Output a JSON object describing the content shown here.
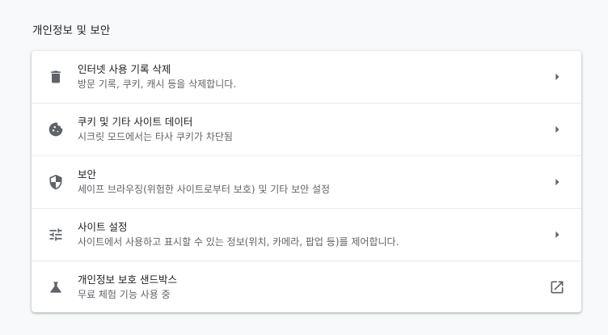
{
  "section_title": "개인정보 및 보안",
  "items": [
    {
      "icon": "trash-icon",
      "label": "인터넷 사용 기록 삭제",
      "sublabel": "방문 기록, 쿠키, 캐시 등을 삭제합니다.",
      "trail": "arrow-right-icon"
    },
    {
      "icon": "cookie-icon",
      "label": "쿠키 및 기타 사이트 데이터",
      "sublabel": "시크릿 모드에서는 타사 쿠키가 차단됨",
      "trail": "arrow-right-icon"
    },
    {
      "icon": "shield-icon",
      "label": "보안",
      "sublabel": "세이프 브라우징(위험한 사이트로부터 보호) 및 기타 보안 설정",
      "trail": "arrow-right-icon"
    },
    {
      "icon": "tune-icon",
      "label": "사이트 설정",
      "sublabel": "사이트에서 사용하고 표시할 수 있는 정보(위치, 카메라, 팝업 등)를 제어합니다.",
      "trail": "arrow-right-icon"
    },
    {
      "icon": "flask-icon",
      "label": "개인정보 보호 샌드박스",
      "sublabel": "무료 체험 기능 사용 중",
      "trail": "open-in-new-icon"
    }
  ]
}
